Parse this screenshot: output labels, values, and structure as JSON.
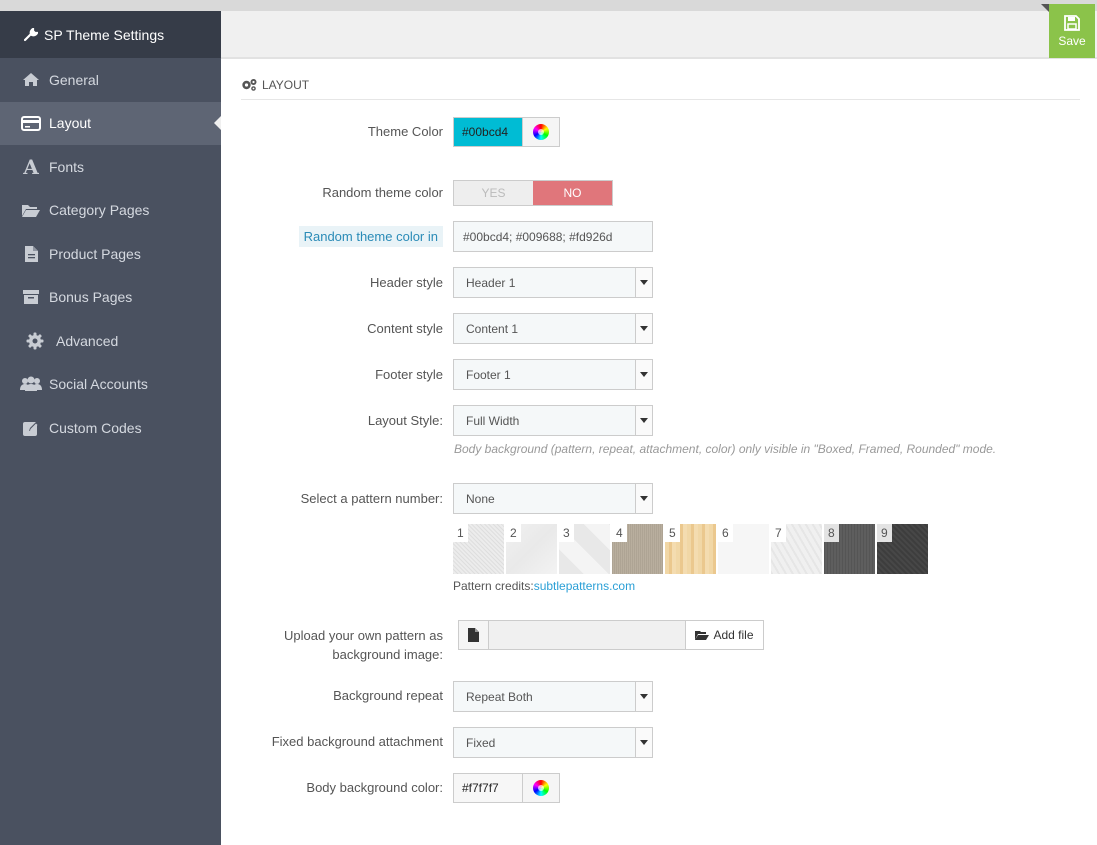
{
  "sidebar": {
    "title": "SP Theme Settings",
    "items": [
      {
        "label": "General",
        "icon": "home-icon"
      },
      {
        "label": "Layout",
        "icon": "credit-card-icon"
      },
      {
        "label": "Fonts",
        "icon": "font-icon"
      },
      {
        "label": "Category Pages",
        "icon": "folder-open-icon"
      },
      {
        "label": "Product Pages",
        "icon": "file-icon"
      },
      {
        "label": "Bonus Pages",
        "icon": "archive-icon"
      },
      {
        "label": "Advanced",
        "icon": "gear-icon"
      },
      {
        "label": "Social Accounts",
        "icon": "users-icon"
      },
      {
        "label": "Custom Codes",
        "icon": "edit-icon"
      }
    ],
    "active": "Layout"
  },
  "toolbar": {
    "save_label": "Save"
  },
  "section": {
    "title": "LAYOUT"
  },
  "form": {
    "theme_color": {
      "label": "Theme Color",
      "value": "#00bcd4"
    },
    "random_theme": {
      "label": "Random theme color",
      "yes": "YES",
      "no": "NO",
      "selected": "NO"
    },
    "random_colors": {
      "label": "Random theme color in",
      "value": "#00bcd4; #009688; #fd926d"
    },
    "header_style": {
      "label": "Header style",
      "value": "Header 1"
    },
    "content_style": {
      "label": "Content style",
      "value": "Content 1"
    },
    "footer_style": {
      "label": "Footer style",
      "value": "Footer 1"
    },
    "layout_style": {
      "label": "Layout Style:",
      "value": "Full Width",
      "help": "Body background (pattern, repeat, attachment, color) only visible in \"Boxed, Framed, Rounded\" mode."
    },
    "pattern": {
      "label": "Select a pattern number:",
      "value": "None",
      "swatches": [
        "1",
        "2",
        "3",
        "4",
        "5",
        "6",
        "7",
        "8",
        "9"
      ],
      "credits_label": "Pattern credits:",
      "credits_link": "subtlepatterns.com"
    },
    "upload": {
      "label": "Upload your own pattern as background image:",
      "button": "Add file"
    },
    "bg_repeat": {
      "label": "Background repeat",
      "value": "Repeat Both"
    },
    "bg_attachment": {
      "label": "Fixed background attachment",
      "value": "Fixed"
    },
    "body_bg": {
      "label": "Body background color:",
      "value": "#f7f7f7"
    }
  },
  "colors": {
    "sidebar": "#4a5160",
    "accent": "#00bcd4",
    "save": "#8bc34a",
    "toggle_no": "#e0767b",
    "link": "#2a9fd6"
  }
}
